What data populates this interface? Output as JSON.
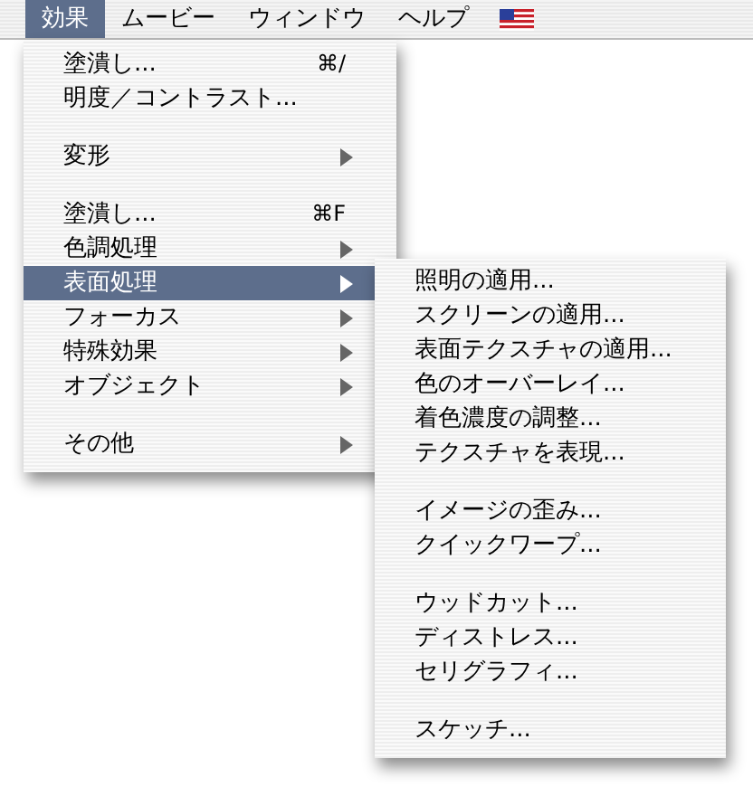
{
  "menubar": [
    {
      "label": "効果",
      "selected": true
    },
    {
      "label": "ムービー",
      "selected": false
    },
    {
      "label": "ウィンドウ",
      "selected": false
    },
    {
      "label": "ヘルプ",
      "selected": false
    },
    {
      "kind": "flag"
    }
  ],
  "menu": [
    {
      "kind": "item",
      "label": "塗潰し...",
      "shortcut": "⌘/",
      "submenu": false,
      "selected": false
    },
    {
      "kind": "item",
      "label": "明度／コントラスト...",
      "submenu": false,
      "selected": false
    },
    {
      "kind": "separator"
    },
    {
      "kind": "item",
      "label": "変形",
      "submenu": true,
      "selected": false
    },
    {
      "kind": "separator"
    },
    {
      "kind": "item",
      "label": "塗潰し...",
      "shortcut": "⌘F",
      "submenu": false,
      "selected": false
    },
    {
      "kind": "item",
      "label": "色調処理",
      "submenu": true,
      "selected": false
    },
    {
      "kind": "item",
      "label": "表面処理",
      "submenu": true,
      "selected": true
    },
    {
      "kind": "item",
      "label": "フォーカス",
      "submenu": true,
      "selected": false
    },
    {
      "kind": "item",
      "label": "特殊効果",
      "submenu": true,
      "selected": false
    },
    {
      "kind": "item",
      "label": "オブジェクト",
      "submenu": true,
      "selected": false
    },
    {
      "kind": "separator"
    },
    {
      "kind": "item",
      "label": "その他",
      "submenu": true,
      "selected": false
    }
  ],
  "submenu": [
    {
      "kind": "item",
      "label": "照明の適用..."
    },
    {
      "kind": "item",
      "label": "スクリーンの適用..."
    },
    {
      "kind": "item",
      "label": "表面テクスチャの適用..."
    },
    {
      "kind": "item",
      "label": "色のオーバーレイ..."
    },
    {
      "kind": "item",
      "label": "着色濃度の調整..."
    },
    {
      "kind": "item",
      "label": "テクスチャを表現..."
    },
    {
      "kind": "separator"
    },
    {
      "kind": "item",
      "label": "イメージの歪み..."
    },
    {
      "kind": "item",
      "label": "クイックワープ..."
    },
    {
      "kind": "separator"
    },
    {
      "kind": "item",
      "label": "ウッドカット..."
    },
    {
      "kind": "item",
      "label": "ディストレス..."
    },
    {
      "kind": "item",
      "label": "セリグラフィ..."
    },
    {
      "kind": "separator"
    },
    {
      "kind": "item",
      "label": "スケッチ..."
    }
  ]
}
